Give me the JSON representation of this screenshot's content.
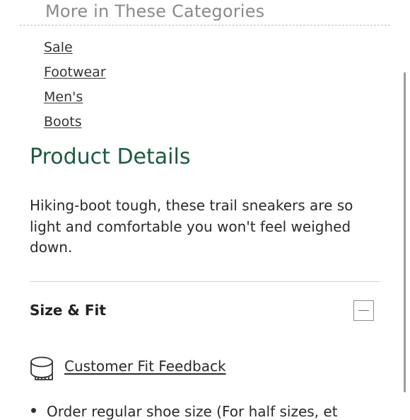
{
  "categories": {
    "heading": "More in These Categories",
    "items": [
      {
        "label": "Sale"
      },
      {
        "label": "Footwear"
      },
      {
        "label": "Men's"
      },
      {
        "label": "Boots"
      }
    ]
  },
  "product_details": {
    "title": "Product Details",
    "description": "Hiking-boot tough, these trail sneakers are so light and comfortable you won't feel weighed down."
  },
  "size_fit": {
    "title": "Size & Fit",
    "toggle_icon": "minus-icon",
    "feedback_icon": "measuring-tape-icon",
    "feedback_link": "Customer Fit Feedback",
    "bullet_partial": "Order regular shoe size (For half sizes, et"
  },
  "colors": {
    "accent_green": "#1d5a3f",
    "heading_gray": "#8a8a8a"
  }
}
